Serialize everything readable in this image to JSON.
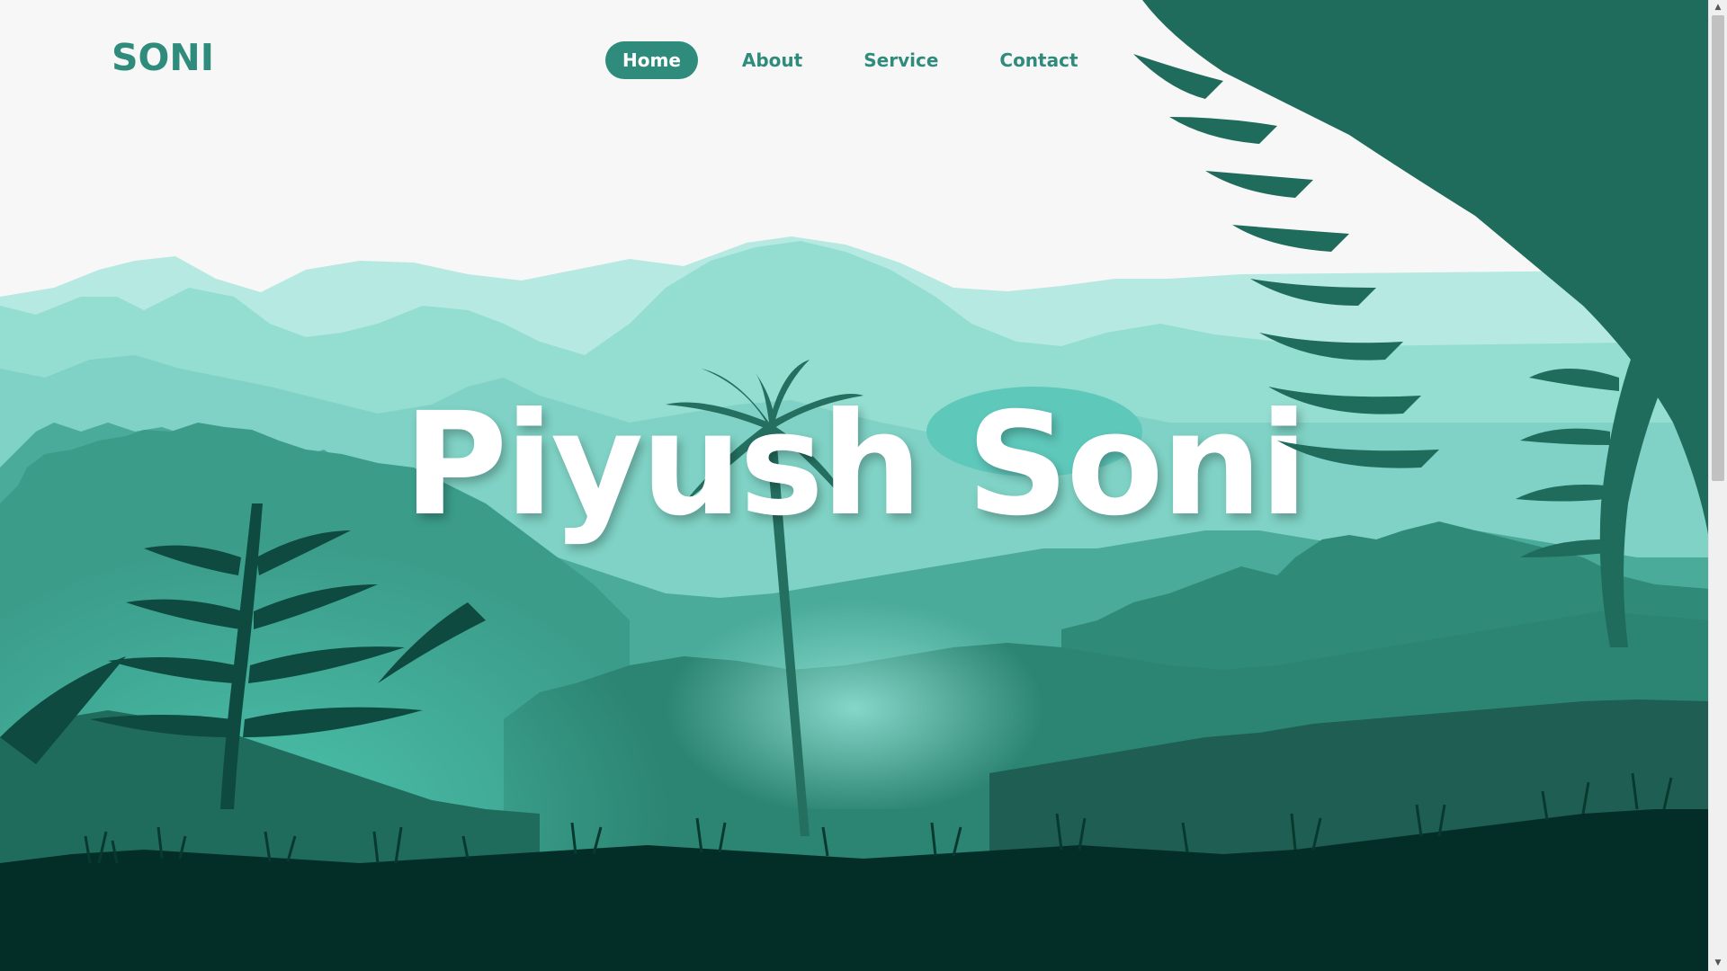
{
  "header": {
    "logo": "SONI",
    "nav": [
      {
        "label": "Home",
        "active": true
      },
      {
        "label": "About",
        "active": false
      },
      {
        "label": "Service",
        "active": false
      },
      {
        "label": "Contact",
        "active": false
      }
    ]
  },
  "hero": {
    "title": "Piyush Soni"
  },
  "theme": {
    "brand": "#2f8c7c",
    "background": "#f7f7f7",
    "hero_text": "#ffffff",
    "mountain_light": "#b3e8e0",
    "mountain_mid": "#8fdcd0",
    "forest_mid": "#3fa594",
    "forest_dark": "#1f6b5c",
    "ground": "#032e27"
  },
  "illustration": {
    "name": "jungle-landscape-illustration",
    "elements": [
      "mountains",
      "palm-tree",
      "fern-leaves",
      "grass"
    ]
  },
  "scrollbar": {
    "up_icon": "arrow-up-icon",
    "down_icon": "arrow-down-icon"
  }
}
